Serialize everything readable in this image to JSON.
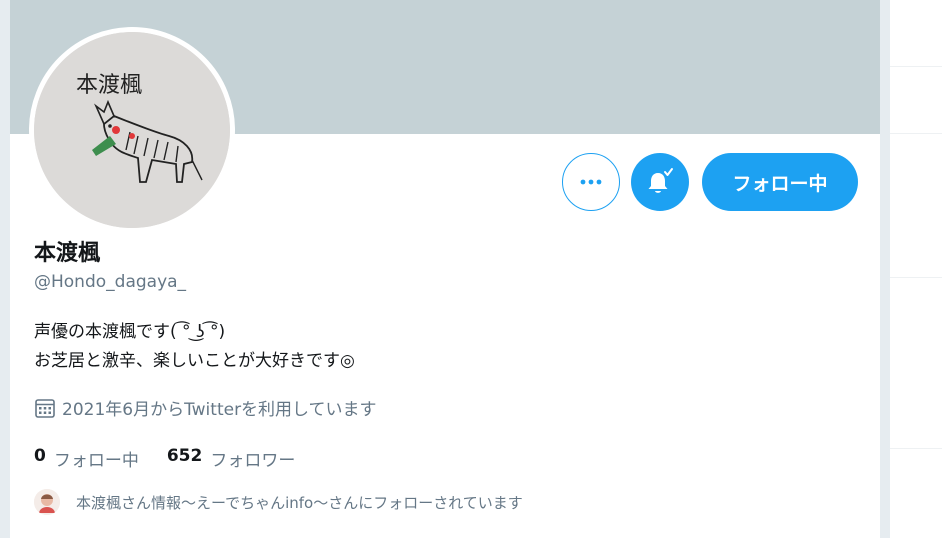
{
  "profile": {
    "display_name": "本渡楓",
    "handle": "@Hondo_dagaya_",
    "bio_line1": "声優の本渡楓です( ͡° ͜ʖ ͡°)",
    "bio_line2": "お芝居と激辛、楽しいことが大好きです◎",
    "joined": "2021年6月からTwitterを利用しています",
    "avatar_caption": "本渡楓"
  },
  "stats": {
    "following_count": "0",
    "following_label": "フォロー中",
    "followers_count": "652",
    "followers_label": "フォロワー"
  },
  "actions": {
    "follow_label": "フォロー中"
  },
  "followed_by": {
    "text": "本渡楓さん情報〜えーでちゃんinfo〜さんにフォローされています"
  },
  "icons": {
    "more": "more-icon",
    "bell": "notification-bell-icon",
    "calendar": "calendar-icon"
  },
  "colors": {
    "accent": "#1da1f2",
    "banner": "#c5d2d6",
    "text_primary": "#14171a",
    "text_secondary": "#657786"
  }
}
